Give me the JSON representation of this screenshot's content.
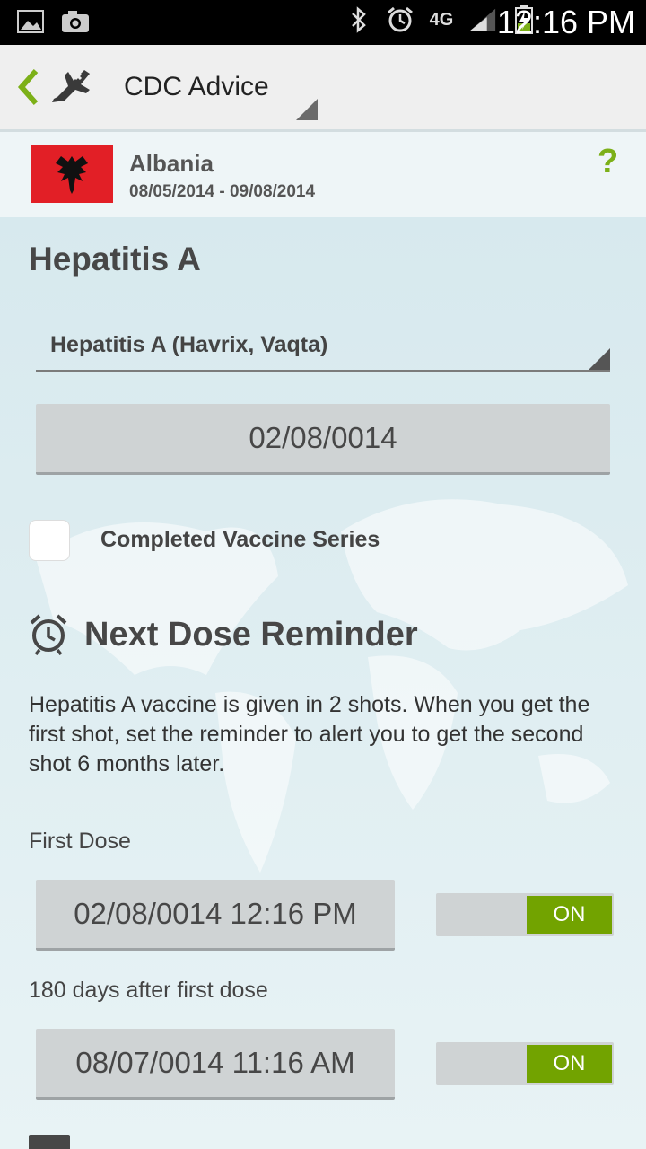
{
  "status_bar": {
    "time": "12:16 PM",
    "icons": [
      "gallery-icon",
      "camera-icon",
      "bluetooth-icon",
      "alarm-icon",
      "4g-lte-icon",
      "signal-icon",
      "battery-charging-icon"
    ],
    "network_label": "4G"
  },
  "action_bar": {
    "title": "CDC Advice"
  },
  "trip": {
    "country": "Albania",
    "dates": "08/05/2014 - 09/08/2014",
    "help": "?"
  },
  "vaccine": {
    "title": "Hepatitis A",
    "selected_option": "Hepatitis A (Havrix, Vaqta)",
    "date": "02/08/0014",
    "completed_label": "Completed Vaccine Series",
    "completed_checked": false
  },
  "reminder": {
    "title": "Next Dose Reminder",
    "description": "Hepatitis A vaccine is given in 2 shots. When you get the first shot, set the reminder to alert you to get the second shot 6 months later.",
    "doses": [
      {
        "label": "First Dose",
        "datetime": "02/08/0014 12:16 PM",
        "toggle": "ON"
      },
      {
        "label": "180 days after first dose",
        "datetime": "08/07/0014 11:16 AM",
        "toggle": "ON"
      }
    ]
  },
  "colors": {
    "accent": "#72a300",
    "help": "#7cb018",
    "flag_red": "#e21f26"
  }
}
